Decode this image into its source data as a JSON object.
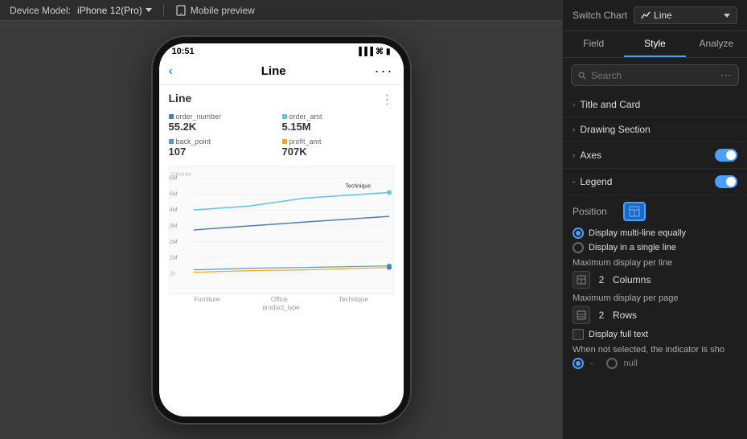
{
  "topbar": {
    "device_model_label": "Device Model:",
    "device_model_value": "iPhone 12(Pro)",
    "mobile_preview_label": "Mobile preview"
  },
  "phone": {
    "status_time": "10:51",
    "nav_title": "Line",
    "chart_title": "Line",
    "metrics": [
      {
        "label": "order_number",
        "value": "55.2K",
        "color": "#4a7ebb"
      },
      {
        "label": "order_amt",
        "value": "5.15M",
        "color": "#5bc4e8"
      },
      {
        "label": "back_point",
        "value": "107",
        "color": "#5599cc"
      },
      {
        "label": "profit_amt",
        "value": "707K",
        "color": "#f5a623"
      }
    ],
    "chart_y_label": "Calculate",
    "chart_annotation": "Technique",
    "x_labels": [
      "Furniture",
      "Office",
      "Technique"
    ],
    "x_axis_title": "product_type",
    "y_values": [
      "6M",
      "5M",
      "4M",
      "3M",
      "2M",
      "1M",
      "0"
    ]
  },
  "right_panel": {
    "switch_chart_label": "Switch Chart",
    "chart_type": "Line",
    "tabs": [
      "Field",
      "Style",
      "Analyze"
    ],
    "active_tab": "Style",
    "search_placeholder": "Search",
    "sections": [
      {
        "label": "Title and Card",
        "expanded": false
      },
      {
        "label": "Drawing Section",
        "expanded": false
      },
      {
        "label": "Axes",
        "expanded": false,
        "toggle": true,
        "toggle_on": true
      },
      {
        "label": "Legend",
        "expanded": true,
        "toggle": true,
        "toggle_on": true
      }
    ],
    "legend": {
      "position_label": "Position",
      "radio_options": [
        "Display multi-line equally",
        "Display in a single line"
      ],
      "selected_radio": 0,
      "max_per_line_label": "Maximum display per line",
      "max_per_line_value": "2",
      "max_per_line_suffix": "Columns",
      "max_per_page_label": "Maximum display per page",
      "max_per_page_value": "2",
      "max_per_page_suffix": "Rows",
      "display_full_text_label": "Display full text",
      "when_not_selected_label": "When not selected, the indicator is sho",
      "null_radio_options": [
        "-",
        "null"
      ],
      "selected_null_radio": 0
    }
  }
}
